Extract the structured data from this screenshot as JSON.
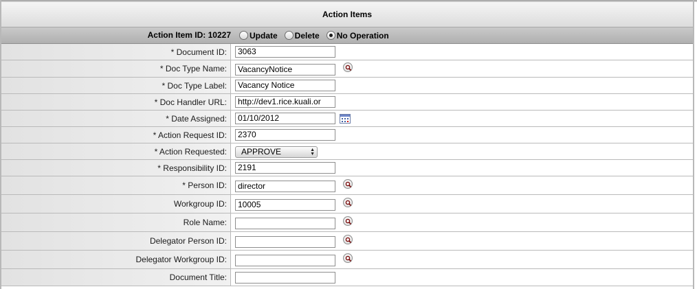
{
  "section": {
    "title": "Action Items"
  },
  "action_item": {
    "id_label": "Action Item ID: 10227",
    "operations": [
      {
        "label": "Update",
        "checked": false
      },
      {
        "label": "Delete",
        "checked": false
      },
      {
        "label": "No Operation",
        "checked": true
      }
    ]
  },
  "fields": {
    "document_id": {
      "label": "* Document ID:",
      "value": "3063"
    },
    "doc_type_name": {
      "label": "* Doc Type Name:",
      "value": "VacancyNotice"
    },
    "doc_type_label": {
      "label": "* Doc Type Label:",
      "value": "Vacancy Notice"
    },
    "doc_handler_url": {
      "label": "* Doc Handler URL:",
      "value": "http://dev1.rice.kuali.or"
    },
    "date_assigned": {
      "label": "* Date Assigned:",
      "value": "01/10/2012"
    },
    "action_request_id": {
      "label": "* Action Request ID:",
      "value": "2370"
    },
    "action_requested": {
      "label": "* Action Requested:",
      "value": "APPROVE"
    },
    "responsibility_id": {
      "label": "* Responsibility ID:",
      "value": "2191"
    },
    "person_id": {
      "label": "* Person ID:",
      "value": "director"
    },
    "workgroup_id": {
      "label": "Workgroup ID:",
      "value": "10005"
    },
    "role_name": {
      "label": "Role Name:",
      "value": ""
    },
    "delegator_person_id": {
      "label": "Delegator Person ID:",
      "value": ""
    },
    "delegator_workgroup_id": {
      "label": "Delegator Workgroup ID:",
      "value": ""
    },
    "document_title": {
      "label": "Document Title:",
      "value": ""
    }
  },
  "icons": {
    "lookup": "magnifier-lookup-icon",
    "calendar": "calendar-icon",
    "select_arrows": "up-down-arrows-icon"
  }
}
